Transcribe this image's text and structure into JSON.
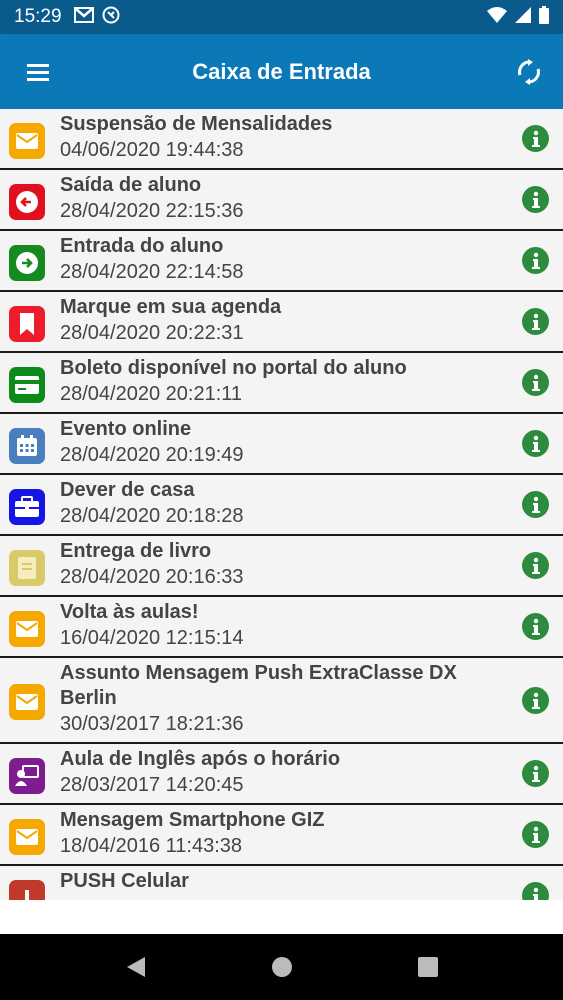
{
  "status_bar": {
    "time": "15:29"
  },
  "header": {
    "title": "Caixa de Entrada"
  },
  "messages": [
    {
      "title": "Suspensão de Mensalidades",
      "date": "04/06/2020 19:44:38",
      "icon": "envelope-icon",
      "color": "#f5a800"
    },
    {
      "title": "Saída de aluno",
      "date": "28/04/2020 22:15:36",
      "icon": "arrow-left-icon",
      "color": "#e0101e"
    },
    {
      "title": "Entrada do aluno",
      "date": "28/04/2020 22:14:58",
      "icon": "arrow-right-icon",
      "color": "#168a1e"
    },
    {
      "title": "Marque em sua agenda",
      "date": "28/04/2020 20:22:31",
      "icon": "bookmark-icon",
      "color": "#ee1c2b"
    },
    {
      "title": "Boleto disponível no portal do aluno",
      "date": "28/04/2020 20:21:11",
      "icon": "credit-card-icon",
      "color": "#0c8a1a"
    },
    {
      "title": "Evento online",
      "date": "28/04/2020 20:19:49",
      "icon": "calendar-icon",
      "color": "#4a7fbf"
    },
    {
      "title": "Dever de casa",
      "date": "28/04/2020 20:18:28",
      "icon": "briefcase-icon",
      "color": "#1515e6"
    },
    {
      "title": "Entrega de livro",
      "date": "28/04/2020 20:16:33",
      "icon": "book-icon",
      "color": "#d9c968"
    },
    {
      "title": "Volta às aulas!",
      "date": "16/04/2020 12:15:14",
      "icon": "envelope-icon",
      "color": "#f5a800"
    },
    {
      "title": "Assunto Mensagem Push ExtraClasse DX Berlin",
      "date": "30/03/2017 18:21:36",
      "icon": "envelope-icon",
      "color": "#f5a800"
    },
    {
      "title": "Aula de Inglês após o horário",
      "date": "28/03/2017 14:20:45",
      "icon": "teacher-icon",
      "color": "#7d1d8f"
    },
    {
      "title": "Mensagem Smartphone GIZ",
      "date": "18/04/2016 11:43:38",
      "icon": "envelope-icon",
      "color": "#f5a800"
    },
    {
      "title": "PUSH Celular",
      "date": "",
      "icon": "alert-icon",
      "color": "#c0392b"
    }
  ]
}
